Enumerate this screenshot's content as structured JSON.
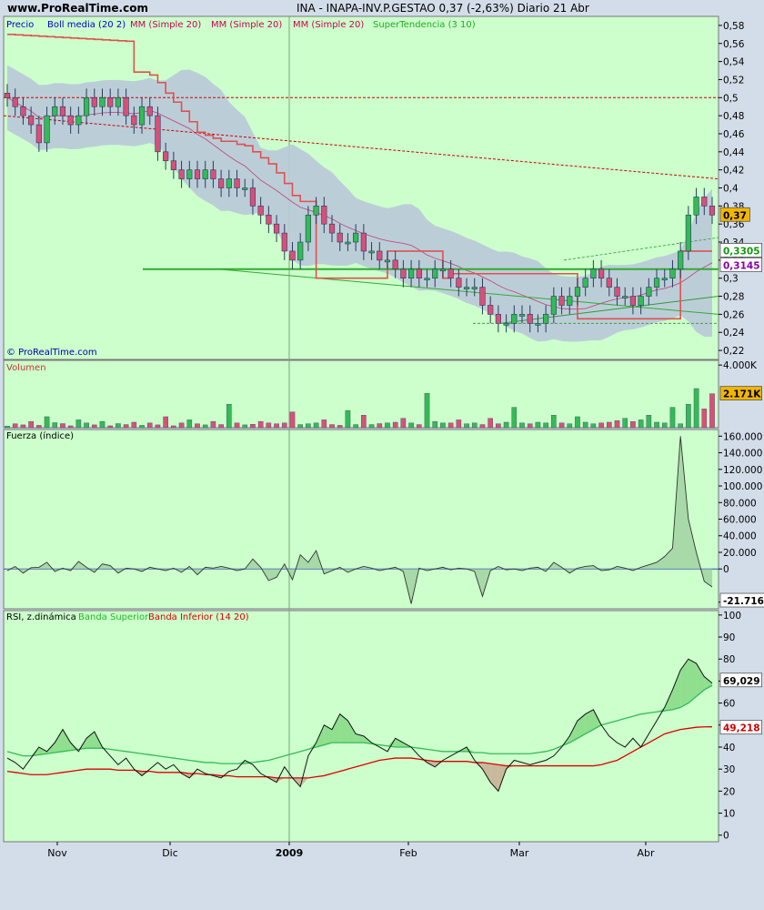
{
  "header": {
    "site": "www.ProRealTime.com",
    "title": "INA - INAPA-INV.P.GESTAO    0,37 (-2,63%)    Diario  21 Abr"
  },
  "watermark": "© ProRealTime.com",
  "colors": {
    "bg": "#ccffcc",
    "band": "#b9c9d9",
    "up": "#33bb55",
    "down": "#d8507a",
    "supertrend": "#e05050",
    "resistance": "#cc0000",
    "support": "#33aa33"
  },
  "x_labels": [
    "Nov",
    "Dic",
    "2009",
    "Feb",
    "Mar",
    "Abr"
  ],
  "chart_data": [
    {
      "type": "candlestick",
      "panel": "price",
      "legend": [
        "Precio",
        "Boll media (20 2)",
        "MM (Simple 20)",
        "MM (Simple 20)",
        "MM (Simple 20)",
        "SuperTendencia (3 10)"
      ],
      "y_ticks": [
        "0,58",
        "0,56",
        "0,54",
        "0,52",
        "0,5",
        "0,48",
        "0,46",
        "0,44",
        "0,42",
        "0,4",
        "0,38",
        "0,36",
        "0,34",
        "0,32",
        "0,3",
        "0,28",
        "0,26",
        "0,24",
        "0,22"
      ],
      "ylim": [
        0.21,
        0.59
      ],
      "last_labels": [
        {
          "text": "0,37",
          "value": 0.37,
          "bg": "#f2b600"
        },
        {
          "text": "0,3305",
          "value": 0.3305,
          "bg": "#ffffff",
          "color": "#119911"
        },
        {
          "text": "0,3145",
          "value": 0.3145,
          "bg": "#ffffff",
          "color": "#8800aa"
        }
      ],
      "close": [
        0.5,
        0.49,
        0.48,
        0.47,
        0.45,
        0.48,
        0.49,
        0.48,
        0.47,
        0.48,
        0.5,
        0.49,
        0.5,
        0.49,
        0.5,
        0.48,
        0.47,
        0.49,
        0.48,
        0.44,
        0.43,
        0.42,
        0.41,
        0.42,
        0.41,
        0.42,
        0.41,
        0.4,
        0.41,
        0.4,
        0.4,
        0.38,
        0.37,
        0.36,
        0.35,
        0.33,
        0.32,
        0.34,
        0.37,
        0.38,
        0.36,
        0.35,
        0.34,
        0.34,
        0.35,
        0.33,
        0.33,
        0.32,
        0.32,
        0.31,
        0.3,
        0.31,
        0.3,
        0.3,
        0.31,
        0.31,
        0.3,
        0.29,
        0.29,
        0.29,
        0.27,
        0.26,
        0.25,
        0.25,
        0.26,
        0.26,
        0.25,
        0.25,
        0.26,
        0.28,
        0.27,
        0.28,
        0.29,
        0.3,
        0.31,
        0.3,
        0.29,
        0.28,
        0.28,
        0.27,
        0.28,
        0.29,
        0.3,
        0.3,
        0.31,
        0.33,
        0.37,
        0.39,
        0.38,
        0.37
      ]
    },
    {
      "type": "bar",
      "panel": "volume",
      "title": "Volumen",
      "y_ticks": [
        "4.000K"
      ],
      "last_label": "2.171K",
      "last_value": 2171,
      "ylim": [
        0,
        4300
      ],
      "values": [
        100,
        250,
        180,
        400,
        150,
        700,
        320,
        260,
        120,
        500,
        300,
        180,
        400,
        120,
        260,
        200,
        350,
        150,
        300,
        180,
        700,
        120,
        300,
        500,
        250,
        180,
        400,
        200,
        1500,
        300,
        180,
        220,
        400,
        300,
        250,
        300,
        1000,
        200,
        250,
        300,
        500,
        200,
        150,
        1100,
        200,
        800,
        200,
        260,
        300,
        350,
        600,
        300,
        200,
        2200,
        400,
        300,
        300,
        500,
        250,
        300,
        200,
        600,
        250,
        350,
        1300,
        300,
        250,
        350,
        300,
        800,
        300,
        250,
        700,
        350,
        250,
        300,
        350,
        450,
        600,
        400,
        500,
        800,
        350,
        300,
        1300,
        250,
        1500,
        2500,
        1200,
        2171
      ]
    },
    {
      "type": "area",
      "panel": "force",
      "title": "Fuerza (índice)",
      "y_ticks": [
        "160.000",
        "140.000",
        "120.000",
        "100.000",
        "80.000",
        "60.000",
        "40.000",
        "20.000",
        "0",
        "-40.000"
      ],
      "last_label": "-21.716",
      "last_value": -21716,
      "ylim": [
        -48000,
        168000
      ],
      "values": [
        -2000,
        3000,
        -5000,
        1500,
        2000,
        8000,
        -3000,
        1000,
        -2000,
        9000,
        2000,
        -4000,
        6000,
        4000,
        -5000,
        1000,
        0,
        -3000,
        2000,
        0,
        -2000,
        1000,
        -4000,
        3000,
        -7000,
        2000,
        1000,
        3000,
        1000,
        -2000,
        0,
        12000,
        2000,
        -14000,
        -10000,
        6000,
        -13000,
        17000,
        8000,
        22000,
        -6000,
        -2000,
        2000,
        -4000,
        0,
        3000,
        1000,
        -2000,
        0,
        2000,
        -3000,
        -42000,
        1000,
        -2000,
        0,
        2000,
        -1000,
        1000,
        0,
        -3000,
        -33000,
        -2000,
        3000,
        -1000,
        0,
        -2000,
        1000,
        2000,
        -3000,
        8000,
        2000,
        -5000,
        1000,
        3000,
        4000,
        -2000,
        -1000,
        3000,
        1000,
        -2000,
        2000,
        5000,
        8000,
        15000,
        25000,
        160000,
        60000,
        20000,
        -15000,
        -21716
      ]
    },
    {
      "type": "line",
      "panel": "rsi",
      "title": "RSI, z.dinámica",
      "legend": [
        {
          "name": "Banda Superior",
          "color": "#22bb22"
        },
        {
          "name": "Banda Inferior (14 20)",
          "color": "#dd0000"
        }
      ],
      "y_ticks": [
        "100",
        "90",
        "80",
        "70",
        "60",
        "50",
        "40",
        "30",
        "20",
        "10",
        "0"
      ],
      "ylim": [
        -3,
        102
      ],
      "last_labels": [
        {
          "text": "69,029",
          "value": 69.029
        },
        {
          "text": "49,218",
          "value": 49.218
        }
      ],
      "rsi": [
        35,
        33,
        30,
        35,
        40,
        38,
        42,
        48,
        42,
        38,
        44,
        47,
        40,
        36,
        32,
        35,
        30,
        27,
        30,
        33,
        30,
        32,
        28,
        26,
        30,
        28,
        27,
        26,
        29,
        30,
        34,
        32,
        28,
        26,
        24,
        31,
        26,
        22,
        36,
        42,
        50,
        48,
        55,
        52,
        46,
        45,
        42,
        40,
        38,
        44,
        42,
        40,
        36,
        33,
        31,
        34,
        36,
        38,
        40,
        34,
        30,
        24,
        20,
        30,
        34,
        33,
        32,
        33,
        34,
        36,
        40,
        45,
        52,
        55,
        57,
        50,
        45,
        42,
        40,
        44,
        40,
        46,
        52,
        58,
        66,
        75,
        80,
        78,
        72,
        69.029
      ],
      "upper": [
        38,
        37,
        36,
        36,
        36.5,
        37,
        37.5,
        38,
        38.5,
        39,
        39.5,
        39.5,
        39.5,
        39,
        38.5,
        38,
        37.5,
        37,
        36.5,
        36,
        35.5,
        35,
        34.5,
        34,
        33.5,
        33,
        33,
        32.5,
        32.5,
        32.5,
        32.5,
        33,
        33.5,
        34,
        35,
        36,
        37,
        38,
        39,
        40,
        41,
        42,
        42,
        42,
        42,
        42,
        41.5,
        41,
        40.5,
        40,
        40,
        40,
        39.5,
        39,
        38.5,
        38,
        38,
        38,
        38,
        37.5,
        37.5,
        37,
        37,
        37,
        37,
        37,
        37,
        37.5,
        38,
        39,
        40.5,
        42,
        44,
        46,
        48,
        50,
        51,
        52,
        53,
        54,
        55,
        55.5,
        56,
        56.5,
        57,
        58,
        60,
        63,
        66,
        68
      ],
      "lower": [
        29,
        28.5,
        28,
        27.5,
        27.5,
        27.5,
        28,
        28.5,
        29,
        29.5,
        30,
        30,
        30,
        30,
        29.5,
        29.5,
        29.5,
        29,
        29,
        28.5,
        28.5,
        28.5,
        28.5,
        28,
        28,
        27.5,
        27.5,
        27,
        27,
        26.5,
        26.5,
        26.5,
        26.5,
        26.5,
        26,
        26,
        26,
        26,
        26,
        26.5,
        27,
        28,
        29,
        30,
        31,
        32,
        33,
        34,
        34.5,
        35,
        35,
        35,
        34.5,
        34,
        33.5,
        33.5,
        33.5,
        33.5,
        33.5,
        33,
        33,
        32.5,
        32,
        31.5,
        31.5,
        31.5,
        31.5,
        31.5,
        31.5,
        31.5,
        31.5,
        31.5,
        31.5,
        31.5,
        31.5,
        32,
        33,
        34,
        36,
        38,
        40,
        42,
        44,
        46,
        47,
        48,
        48.5,
        49,
        49.2,
        49.218
      ]
    }
  ]
}
